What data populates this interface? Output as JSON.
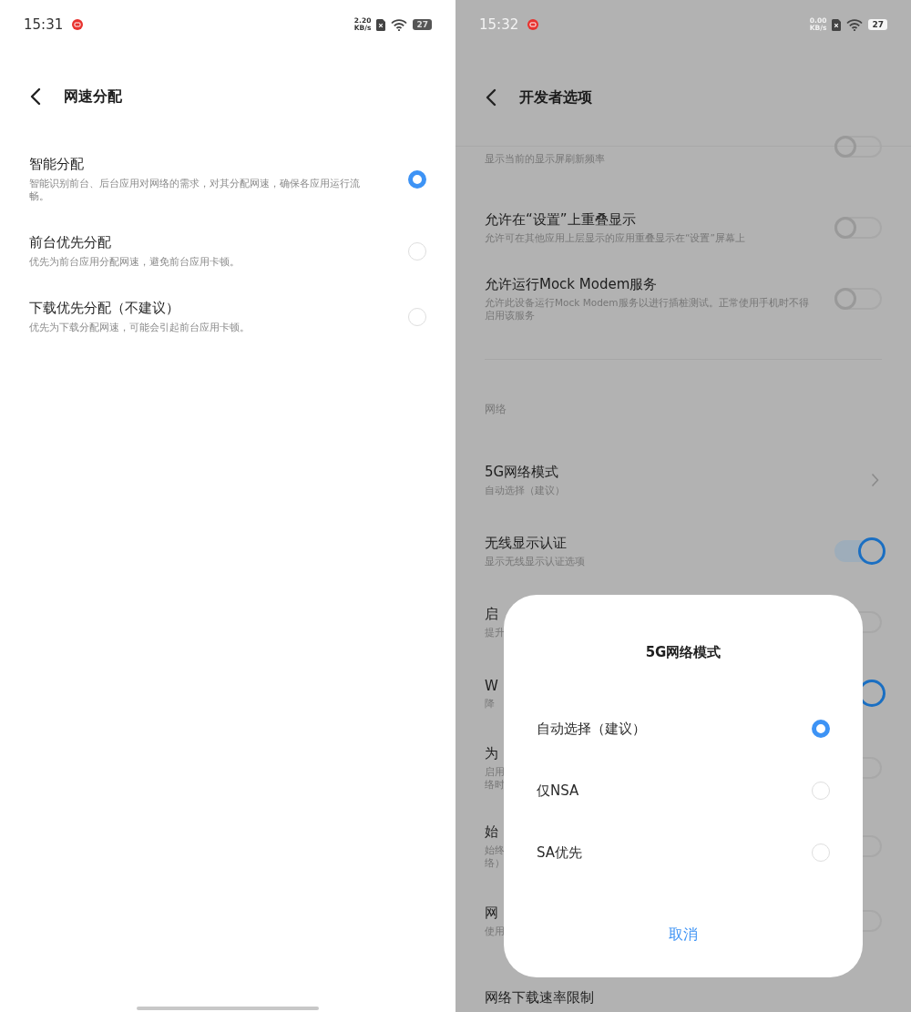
{
  "left_screen": {
    "status_bar": {
      "time": "15:31",
      "speed": "2.20",
      "speed_unit": "KB/s",
      "battery": "27"
    },
    "header": {
      "title": "网速分配"
    },
    "options": [
      {
        "title": "智能分配",
        "description": "智能识别前台、后台应用对网络的需求，对其分配网速，确保各应用运行流畅。",
        "selected": true
      },
      {
        "title": "前台优先分配",
        "description": "优先为前台应用分配网速，避免前台应用卡顿。",
        "selected": false
      },
      {
        "title": "下载优先分配（不建议）",
        "description": "优先为下载分配网速，可能会引起前台应用卡顿。",
        "selected": false
      }
    ]
  },
  "right_screen": {
    "status_bar": {
      "time": "15:32",
      "speed": "0.00",
      "speed_unit": "KB/s",
      "battery": "27"
    },
    "header": {
      "title": "开发者选项"
    },
    "rows": [
      {
        "kind": "toggle",
        "subtitle": "显示当前的显示屏刷新频率",
        "on": false
      },
      {
        "kind": "toggle",
        "title": "允许在“设置”上重叠显示",
        "subtitle": "允许可在其他应用上层显示的应用重叠显示在“设置”屏幕上",
        "on": false
      },
      {
        "kind": "toggle",
        "title": "允许运行Mock Modem服务",
        "subtitle": "允许此设备运行Mock Modem服务以进行插桩测试。正常使用手机时不得启用该服务",
        "on": false
      },
      {
        "kind": "divider"
      },
      {
        "kind": "section",
        "title": "网络"
      },
      {
        "kind": "chevron",
        "title": "5G网络模式",
        "subtitle": "自动选择（建议）"
      },
      {
        "kind": "toggle",
        "title": "无线显示认证",
        "subtitle": "显示无线显示认证选项",
        "on": true
      },
      {
        "kind": "toggle",
        "title": "启",
        "subtitle": "提升",
        "on": false
      },
      {
        "kind": "toggle",
        "title": "W",
        "subtitle": "降",
        "on": true
      },
      {
        "kind": "toggle",
        "title": "为",
        "subtitle_lines": [
          "启用",
          "络时"
        ],
        "on": false
      },
      {
        "kind": "toggle",
        "title": "始",
        "subtitle_lines": [
          "始终",
          "络）"
        ],
        "on": false
      },
      {
        "kind": "toggle",
        "title": "网",
        "subtitle": "使用",
        "on": false
      },
      {
        "kind": "plain",
        "title": "网络下载速率限制"
      }
    ],
    "dialog": {
      "title": "5G网络模式",
      "options": [
        {
          "label": "自动选择（建议）",
          "selected": true
        },
        {
          "label": "仅NSA",
          "selected": false
        },
        {
          "label": "SA优先",
          "selected": false
        }
      ],
      "cancel": "取消"
    }
  }
}
